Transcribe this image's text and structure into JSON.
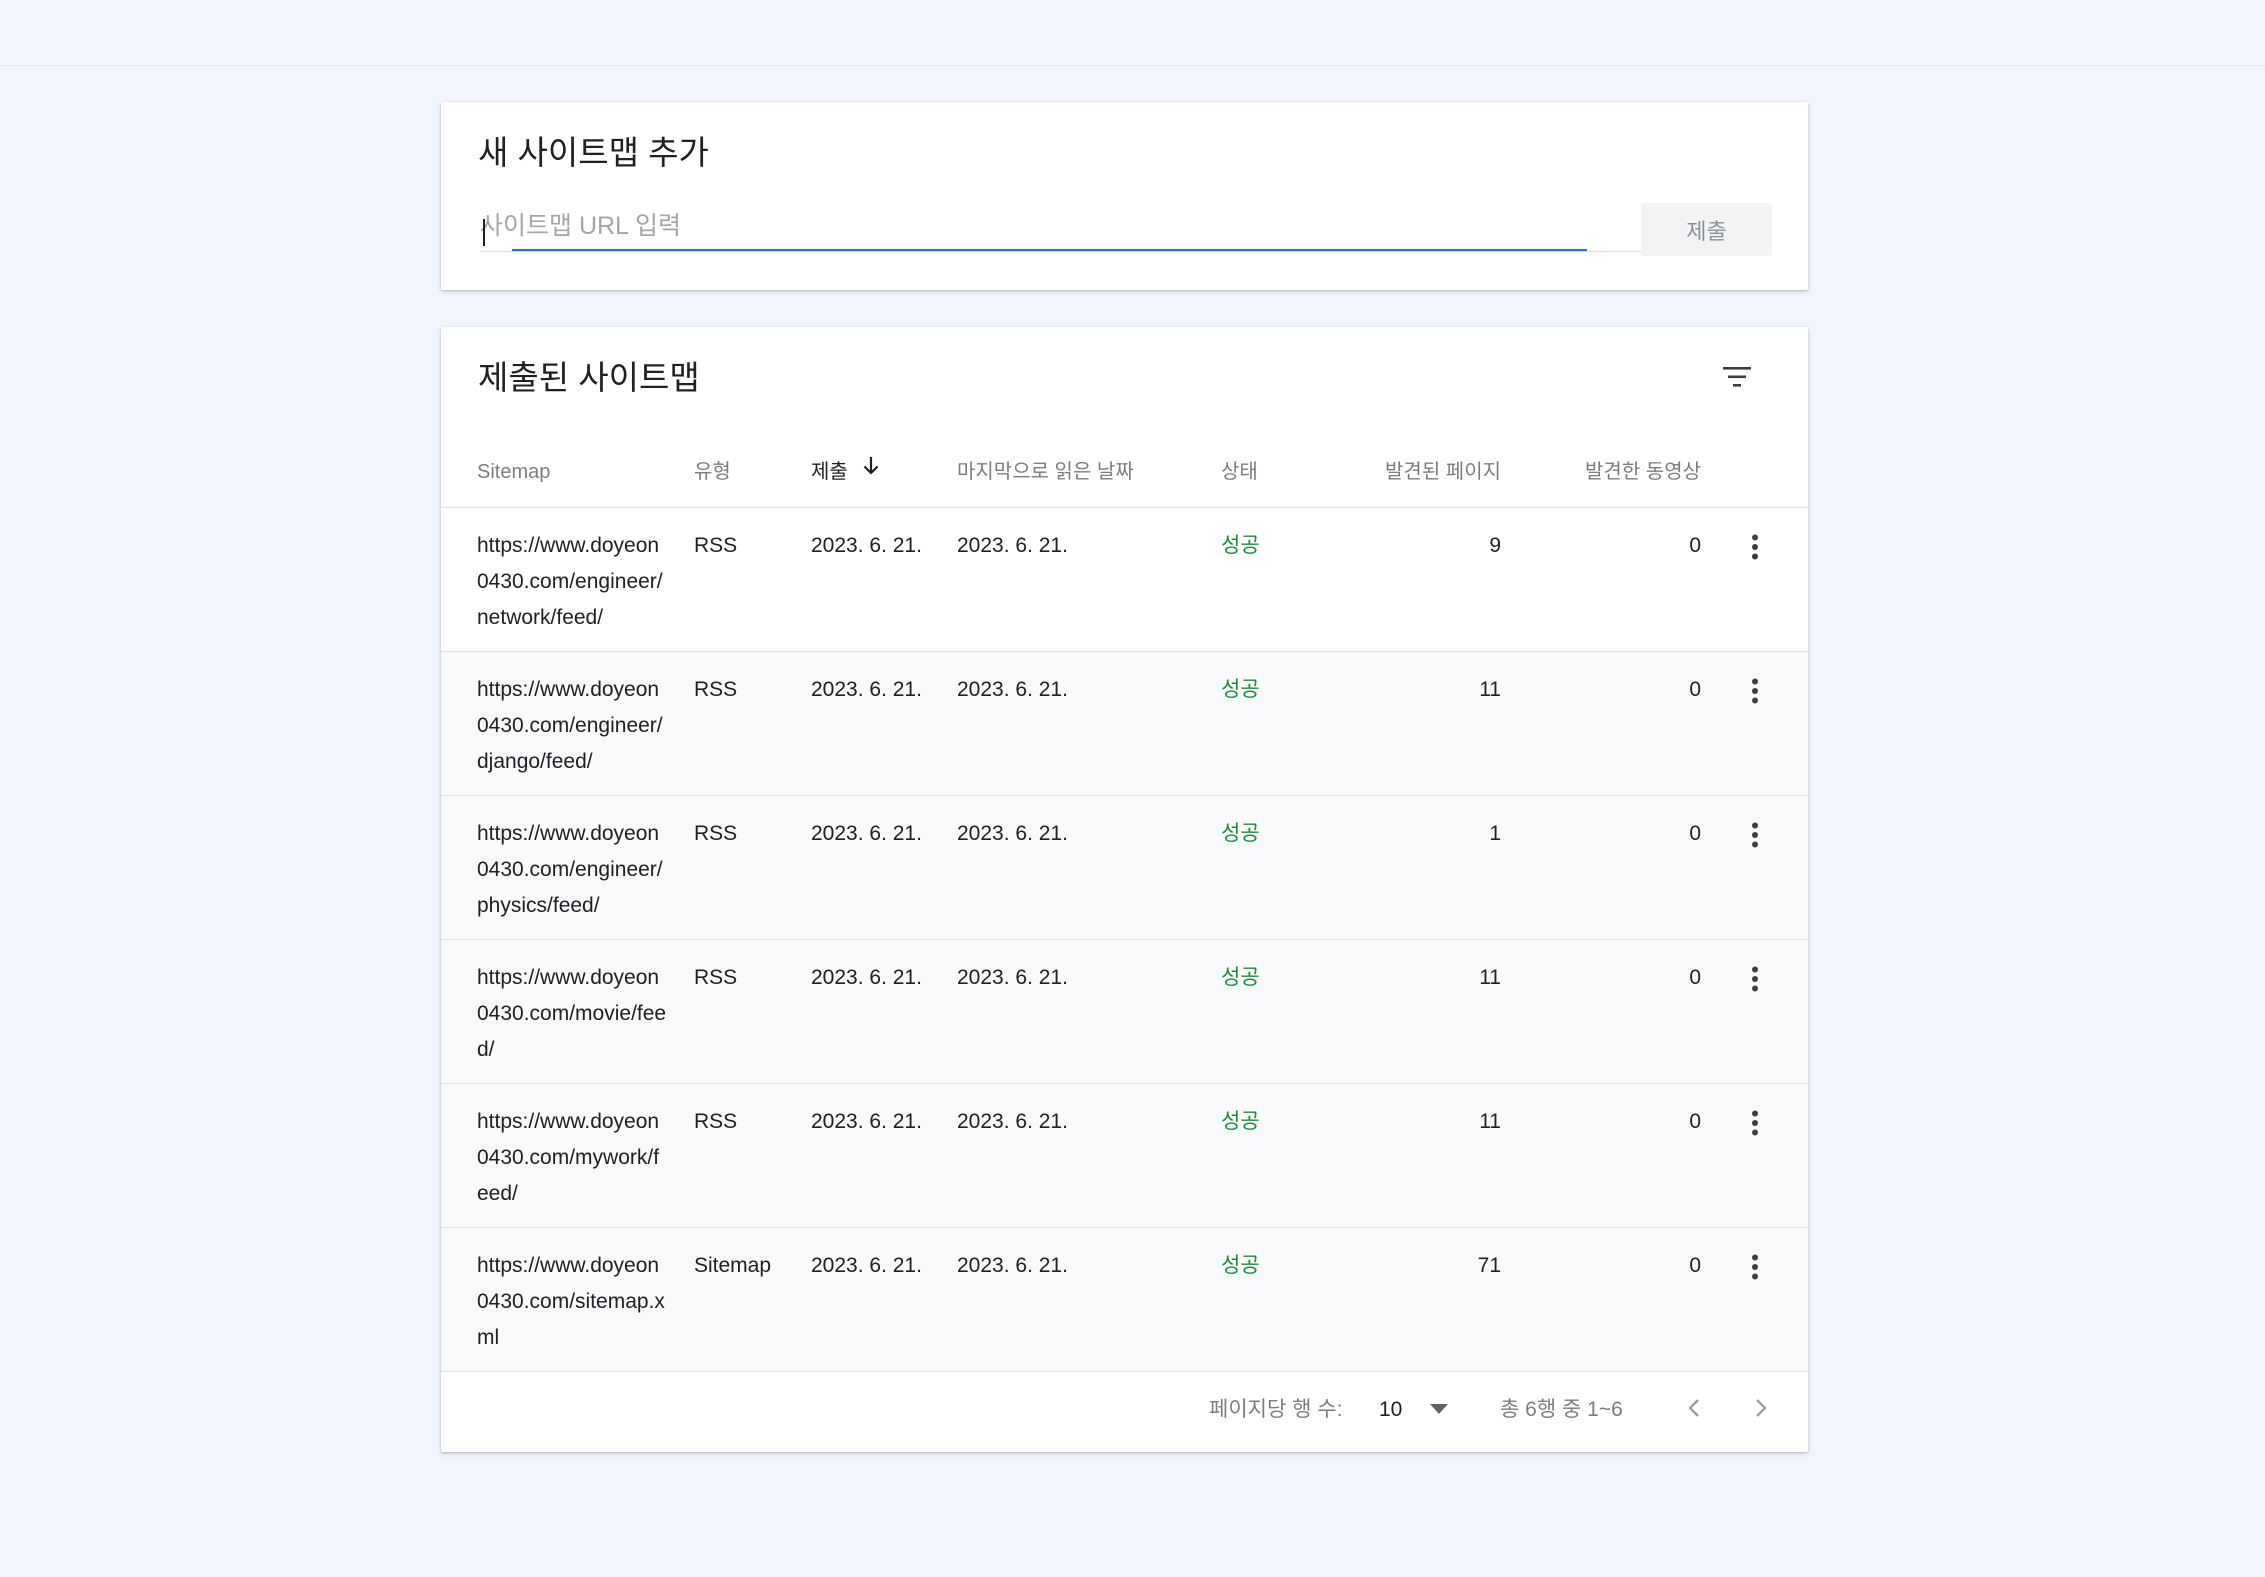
{
  "add_sitemap": {
    "title": "새 사이트맵 추가",
    "input_placeholder": "사이트맵 URL 입력",
    "input_value": "",
    "submit_label": "제출"
  },
  "submitted_sitemaps": {
    "title": "제출된 사이트맵",
    "filter_icon": "filter-icon",
    "columns": {
      "sitemap": "Sitemap",
      "type": "유형",
      "submitted": "제출",
      "last_read": "마지막으로 읽은 날짜",
      "status": "상태",
      "discovered_pages": "발견된 페이지",
      "discovered_videos": "발견한 동영상"
    },
    "sort_icon": "arrow-down-icon",
    "rows": [
      {
        "url": "https://www.doyeon0430.com/engineer/network/feed/",
        "type": "RSS",
        "submitted": "2023. 6. 21.",
        "last_read": "2023. 6. 21.",
        "status": "성공",
        "pages": "9",
        "videos": "0"
      },
      {
        "url": "https://www.doyeon0430.com/engineer/django/feed/",
        "type": "RSS",
        "submitted": "2023. 6. 21.",
        "last_read": "2023. 6. 21.",
        "status": "성공",
        "pages": "11",
        "videos": "0"
      },
      {
        "url": "https://www.doyeon0430.com/engineer/physics/feed/",
        "type": "RSS",
        "submitted": "2023. 6. 21.",
        "last_read": "2023. 6. 21.",
        "status": "성공",
        "pages": "1",
        "videos": "0"
      },
      {
        "url": "https://www.doyeon0430.com/movie/feed/",
        "type": "RSS",
        "submitted": "2023. 6. 21.",
        "last_read": "2023. 6. 21.",
        "status": "성공",
        "pages": "11",
        "videos": "0"
      },
      {
        "url": "https://www.doyeon0430.com/mywork/feed/",
        "type": "RSS",
        "submitted": "2023. 6. 21.",
        "last_read": "2023. 6. 21.",
        "status": "성공",
        "pages": "11",
        "videos": "0"
      },
      {
        "url": "https://www.doyeon0430.com/sitemap.xml",
        "type": "Sitemap",
        "submitted": "2023. 6. 21.",
        "last_read": "2023. 6. 21.",
        "status": "성공",
        "pages": "71",
        "videos": "0"
      }
    ],
    "pagination": {
      "rows_per_page_label": "페이지당 행 수:",
      "rows_per_page_value": "10",
      "range_label": "총 6행 중 1~6"
    }
  },
  "colors": {
    "background": "#f1f5fd",
    "accent": "#1a73e8",
    "status_success": "#1e8e3e"
  }
}
